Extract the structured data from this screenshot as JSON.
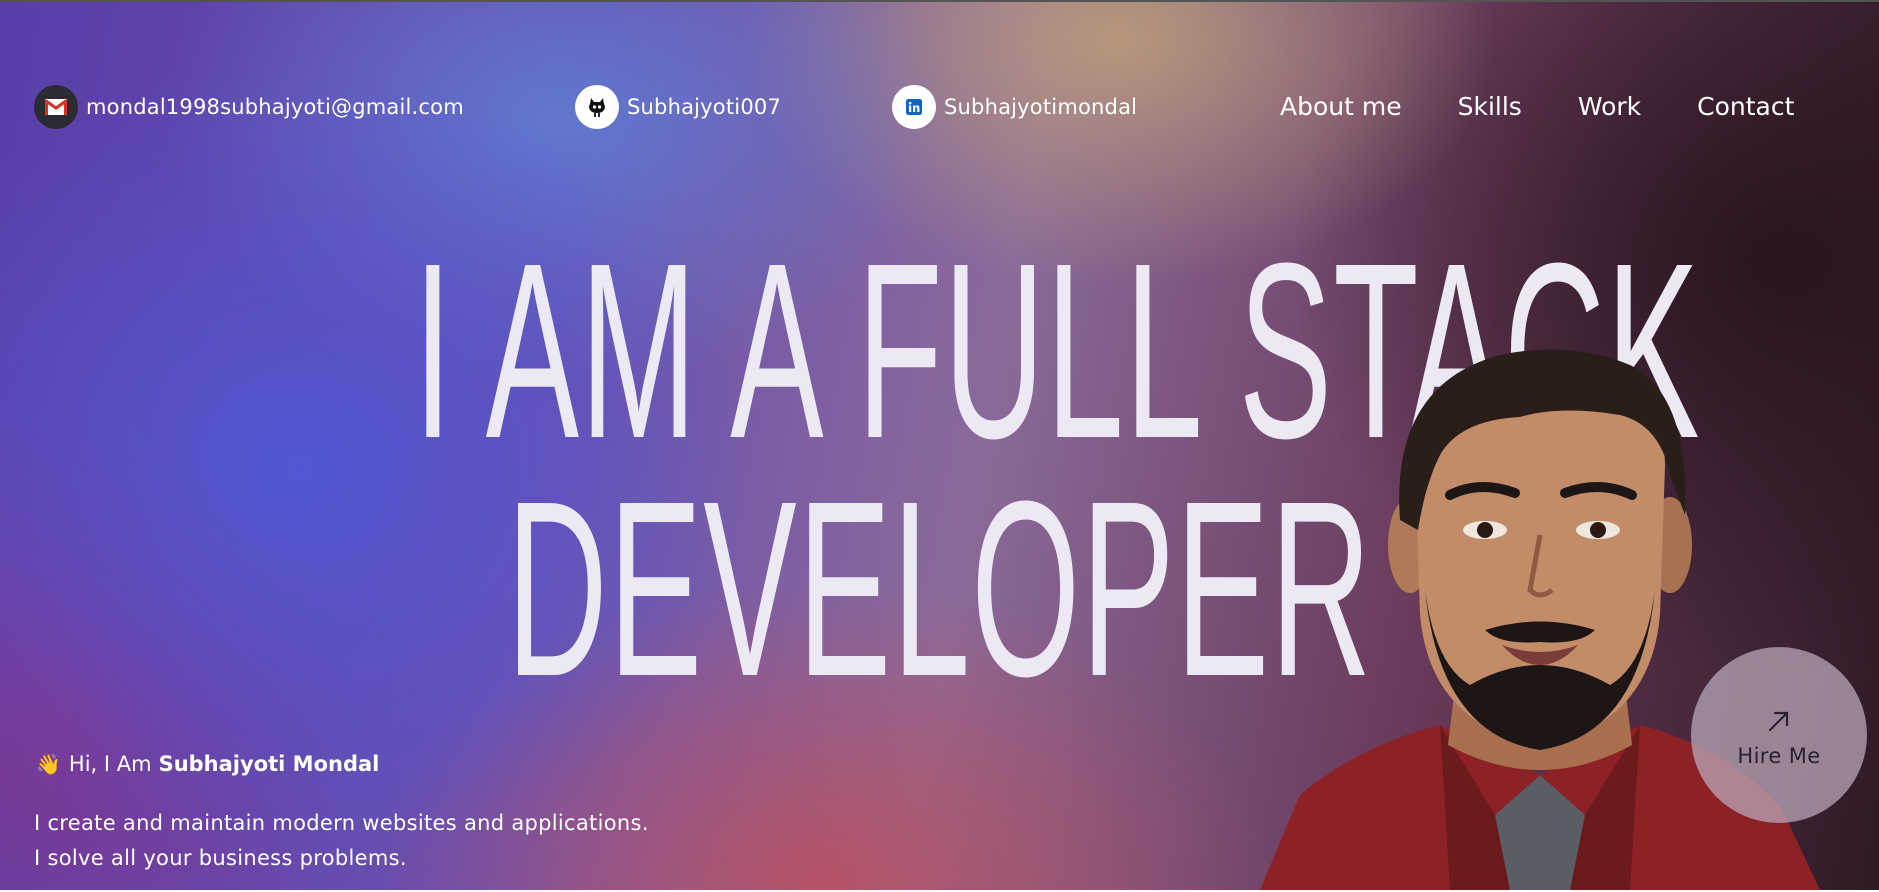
{
  "header": {
    "email": {
      "text": "mondal1998subhajyoti@gmail.com",
      "icon": "gmail-icon"
    },
    "github": {
      "text": "Subhajyoti007",
      "icon": "github-icon"
    },
    "linkedin": {
      "text": "Subhajyotimondal",
      "icon": "linkedin-icon"
    },
    "nav": [
      "About me",
      "Skills",
      "Work",
      "Contact"
    ]
  },
  "hero": {
    "headline_line1": "I AM A FULL STACK",
    "headline_line2": "DEVELOPER",
    "greeting_prefix": "Hi, I Am",
    "greeting_name": "Subhajyoti Mondal",
    "wave_icon": "👋",
    "description_line1": "I create and maintain modern websites and applications.",
    "description_line2": "I solve all your business problems."
  },
  "hire_button": {
    "label": "Hire Me",
    "icon": "arrow-up-right-icon"
  },
  "colors": {
    "text": "#ffffff",
    "headline": "#ece9f5",
    "gradient_blue": "#5058d4",
    "gradient_gold": "#c0a078",
    "gradient_dark": "#26141e",
    "hire_button_bg": "#beacbe"
  }
}
